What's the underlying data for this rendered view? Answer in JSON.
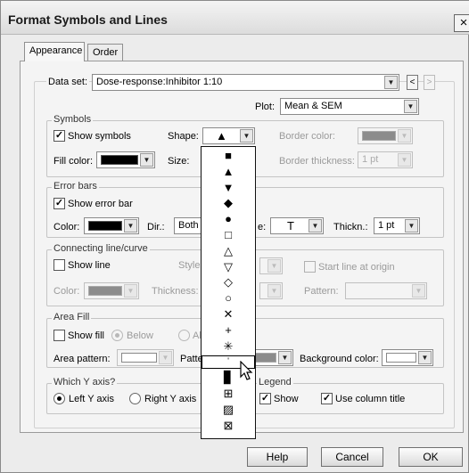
{
  "window": {
    "title": "Format Symbols and Lines",
    "close_glyph": "×"
  },
  "tabs": [
    {
      "label": "Appearance",
      "active": true
    },
    {
      "label": "Order",
      "active": false
    }
  ],
  "dataset": {
    "label": "Data set:",
    "value": "Dose-response:Inhibitor 1:10",
    "prev": "<",
    "next": ">"
  },
  "plot": {
    "label": "Plot:",
    "value": "Mean & SEM"
  },
  "symbols": {
    "legend": "Symbols",
    "show_label": "Show symbols",
    "show_checked": true,
    "shape_label": "Shape:",
    "shape_value": "▲",
    "border_color_label": "Border color:",
    "fill_color_label": "Fill color:",
    "fill_color": "#000000",
    "size_label": "Size:",
    "border_thickness_label": "Border thickness:",
    "border_thickness_value": "1 pt"
  },
  "error_bars": {
    "legend": "Error bars",
    "show_label": "Show error bar",
    "show_checked": true,
    "color_label": "Color:",
    "color": "#000000",
    "dir_label": "Dir.:",
    "dir_value": "Both",
    "style_value": "T",
    "thickness_label": "Thickn.:",
    "thickness_value": "1 pt"
  },
  "connecting": {
    "legend": "Connecting line/curve",
    "show_label": "Show line",
    "show_checked": false,
    "style_label": "Style:",
    "start_label": "Start line at origin",
    "color_label": "Color:",
    "thickness_label": "Thickness:",
    "pattern_label": "Pattern:"
  },
  "area_fill": {
    "legend": "Area Fill",
    "show_label": "Show fill",
    "show_checked": false,
    "below_label": "Below",
    "above_label": "Al",
    "area_pattern_label": "Area pattern:",
    "pattern_label": "Patte",
    "background_color_label": "Background color:"
  },
  "y_axis": {
    "legend": "Which Y axis?",
    "left_label": "Left Y axis",
    "right_label": "Right Y axis"
  },
  "legend_group": {
    "legend": "Legend",
    "show_label": "Show",
    "show_checked": true,
    "use_title_label": "Use column title",
    "use_title_checked": true
  },
  "shape_options": [
    "■",
    "▲",
    "▼",
    "◆",
    "●",
    "□",
    "△",
    "▽",
    "◇",
    "○",
    "✕",
    "+",
    "✳",
    "ˈ",
    "▊",
    "⊞",
    "▨",
    "⊠"
  ],
  "shape_selected_index": 13,
  "buttons": {
    "help": "Help",
    "cancel": "Cancel",
    "ok": "OK"
  },
  "colors": {
    "disabled_gray": "#8c8c8c",
    "window_bg": "#ececec"
  }
}
